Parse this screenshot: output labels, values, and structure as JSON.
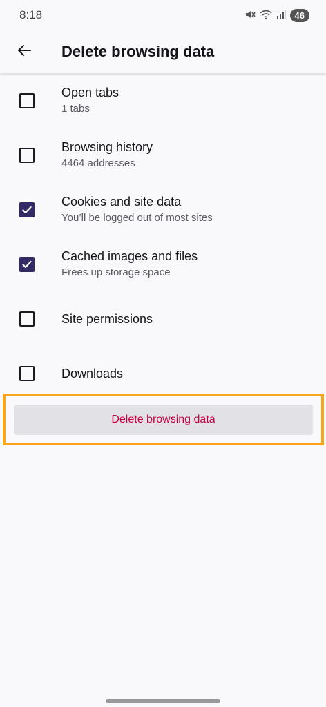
{
  "status_bar": {
    "time": "8:18",
    "battery": "46"
  },
  "app_bar": {
    "title": "Delete browsing data"
  },
  "options": [
    {
      "title": "Open tabs",
      "subtitle": "1 tabs",
      "checked": false
    },
    {
      "title": "Browsing history",
      "subtitle": "4464 addresses",
      "checked": false
    },
    {
      "title": "Cookies and site data",
      "subtitle": "You’ll be logged out of most sites",
      "checked": true
    },
    {
      "title": "Cached images and files",
      "subtitle": "Frees up storage space",
      "checked": true
    },
    {
      "title": "Site permissions",
      "subtitle": "",
      "checked": false
    },
    {
      "title": "Downloads",
      "subtitle": "",
      "checked": false
    }
  ],
  "delete_button": {
    "label": "Delete browsing data"
  },
  "colors": {
    "accent_checkbox": "#312a65",
    "delete_text": "#c50042",
    "highlight": "#f9a51a"
  }
}
